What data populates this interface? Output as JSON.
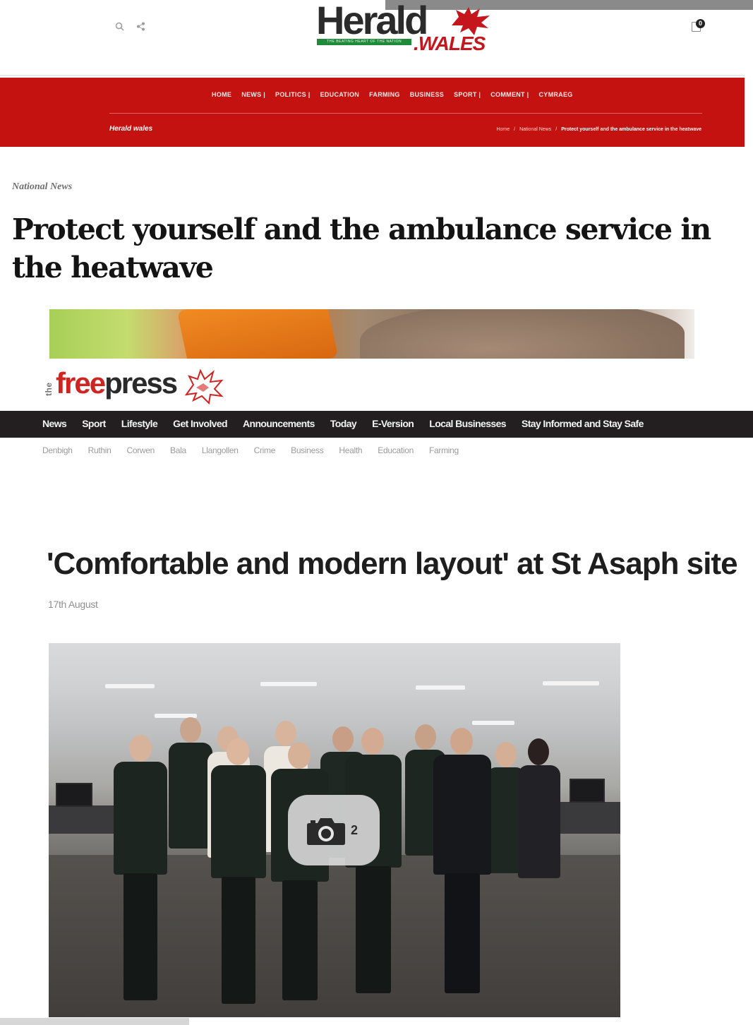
{
  "herald": {
    "logo": {
      "word": "Herald",
      "tagline": "THE BEATING HEART OF THE NATION",
      "suffix": ".WALES"
    },
    "cart_count": "0",
    "nav": [
      "HOME",
      "NEWS |",
      "POLITICS |",
      "EDUCATION",
      "FARMING",
      "BUSINESS",
      "SPORT |",
      "COMMENT |",
      "CYMRAEG"
    ],
    "section_name": "Herald wales",
    "breadcrumb": {
      "home": "Home",
      "sep1": "/",
      "section": "National News",
      "sep2": "/",
      "current": "Protect yourself and the ambulance service in the heatwave"
    },
    "category": "National News",
    "headline": "Protect yourself and the ambulance service in the heatwave"
  },
  "freepress": {
    "logo": {
      "the": "the",
      "free": "free",
      "press": "press"
    },
    "nav": [
      "News",
      "Sport",
      "Lifestyle",
      "Get Involved",
      "Announcements",
      "Today",
      "E-Version",
      "Local Businesses",
      "Stay Informed and Stay Safe"
    ],
    "subnav": [
      "Denbigh",
      "Ruthin",
      "Corwen",
      "Bala",
      "Llangollen",
      "Crime",
      "Business",
      "Health",
      "Education",
      "Farming"
    ],
    "headline": "'Comfortable and modern layout' at St Asaph site",
    "date": "17th August",
    "gallery_count": "2"
  },
  "colors": {
    "herald_red": "#c3120f",
    "freepress_red": "#d02420",
    "freepress_nav": "#231f20"
  },
  "icons": {
    "search": "search-icon",
    "share": "share-icon",
    "cart": "cart-icon",
    "gallery": "camera-icon"
  }
}
